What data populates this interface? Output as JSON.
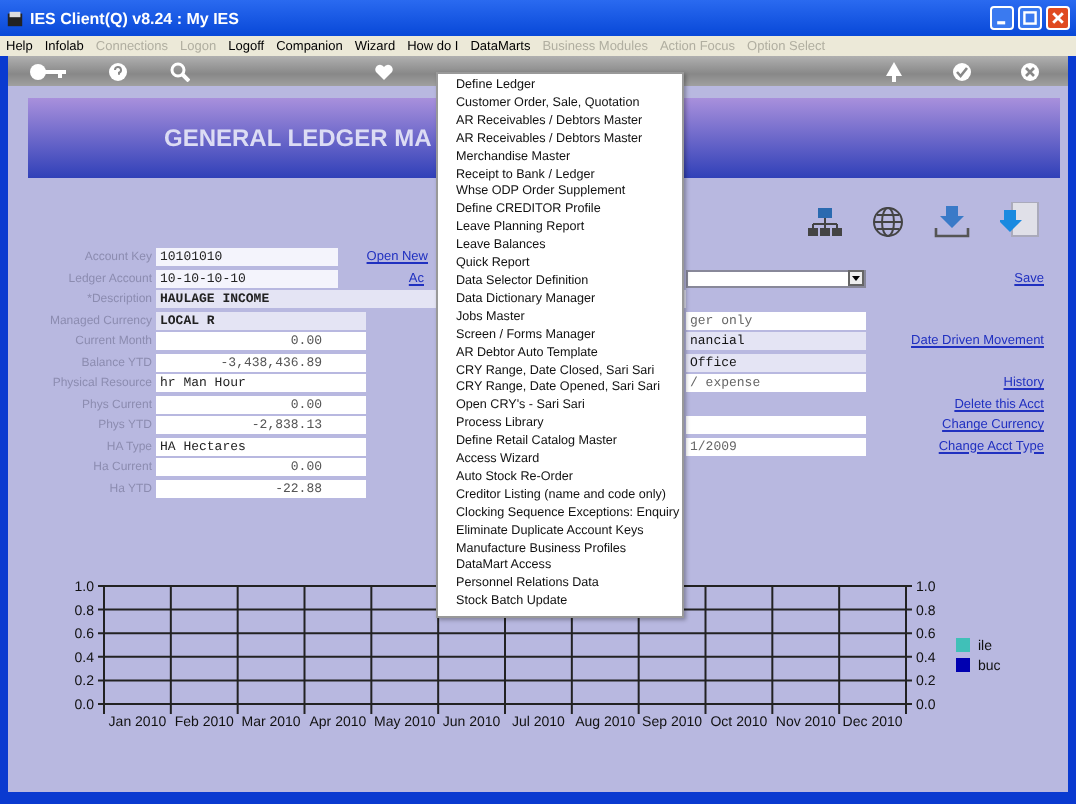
{
  "window": {
    "title": "IES Client(Q) v8.24 : My IES"
  },
  "menu_bar": [
    {
      "label": "Help",
      "disabled": false
    },
    {
      "label": "Infolab",
      "disabled": false
    },
    {
      "label": "Connections",
      "disabled": true
    },
    {
      "label": "Logon",
      "disabled": true
    },
    {
      "label": "Logoff",
      "disabled": false
    },
    {
      "label": "Companion",
      "disabled": false
    },
    {
      "label": "Wizard",
      "disabled": false
    },
    {
      "label": "How do I",
      "disabled": false
    },
    {
      "label": "DataMarts",
      "disabled": false
    },
    {
      "label": "Business Modules",
      "disabled": true
    },
    {
      "label": "Action Focus",
      "disabled": true
    },
    {
      "label": "Option Select",
      "disabled": true
    }
  ],
  "banner": {
    "title": "GENERAL LEDGER MA"
  },
  "form": {
    "fields": [
      {
        "label": "Account Key",
        "value": "10101010",
        "kind": "key"
      },
      {
        "label": "Ledger Account",
        "value": "10-10-10-10",
        "kind": "key"
      },
      {
        "label": "*Description",
        "value": "HAULAGE INCOME",
        "kind": "wide"
      },
      {
        "label": "Managed Currency",
        "value": "LOCAL R",
        "kind": "text"
      },
      {
        "label": "Current Month",
        "value": "0.00",
        "kind": "number"
      },
      {
        "label": "Balance YTD",
        "value": "-3,438,436.89",
        "kind": "number"
      },
      {
        "label": "Physical Resource",
        "value": "hr Man Hour",
        "kind": "text"
      },
      {
        "label": "Phys Current",
        "value": "0.00",
        "kind": "number"
      },
      {
        "label": "Phys YTD",
        "value": "-2,838.13",
        "kind": "number"
      },
      {
        "label": "HA Type",
        "value": "HA Hectares",
        "kind": "text"
      },
      {
        "label": "Ha Current",
        "value": "0.00",
        "kind": "number"
      },
      {
        "label": "Ha YTD",
        "value": "-22.88",
        "kind": "number"
      }
    ],
    "mid_links": [
      "Open New",
      "Ac"
    ],
    "right_fields": [
      {
        "kind": "dropdown"
      },
      {
        "kind": "blank"
      },
      {
        "kind": "field",
        "value": "ger only"
      },
      {
        "kind": "field",
        "value": "nancial"
      },
      {
        "kind": "field",
        "value": "Office"
      },
      {
        "kind": "field",
        "value": "/ expense"
      },
      {
        "kind": "blank"
      },
      {
        "kind": "field"
      },
      {
        "kind": "field",
        "value": "1/2009"
      }
    ],
    "action_links": [
      "Save",
      "Date Driven Movement",
      "History",
      "Delete this Acct",
      "Change Currency",
      "Change Acct Type"
    ]
  },
  "chart": {
    "chart_data": {
      "type": "line",
      "grid": true,
      "categories": [
        "Jan 2010",
        "Feb 2010",
        "Mar 2010",
        "Apr 2010",
        "May 2010",
        "Jun 2010",
        "Jul 2010",
        "Aug 2010",
        "Sep 2010",
        "Oct 2010",
        "Nov 2010",
        "Dec 2010"
      ],
      "ylim": [
        0,
        1
      ],
      "yticks": [
        {
          "value": 0,
          "label": "0.0"
        },
        {
          "value": 0.2,
          "label": "0.2"
        },
        {
          "value": 0.4,
          "label": "0.4"
        },
        {
          "value": 0.6,
          "label": "0.6"
        },
        {
          "value": 0.8,
          "label": "0.8"
        },
        {
          "value": 1,
          "label": "1.0"
        }
      ],
      "series": [
        {
          "name": "ile",
          "color": "#40c0b8",
          "values": [
            null,
            null,
            null,
            null,
            null,
            null,
            null,
            null,
            null,
            null,
            null,
            null
          ]
        },
        {
          "name": "buc",
          "color": "#0000b0",
          "values": [
            null,
            null,
            null,
            null,
            null,
            null,
            null,
            null,
            null,
            null,
            null,
            null
          ]
        }
      ]
    }
  },
  "dropdown_menu": [
    "Define Ledger",
    "Customer Order, Sale, Quotation",
    "AR Receivables / Debtors Master",
    "AR Receivables / Debtors Master",
    "Merchandise Master",
    "Receipt to Bank / Ledger",
    "Whse ODP Order Supplement",
    "Define CREDITOR Profile",
    "Leave Planning Report",
    "Leave Balances",
    "Quick Report",
    "Data Selector Definition",
    "Data Dictionary Manager",
    "Jobs Master",
    "Screen / Forms Manager",
    "AR Debtor Auto Template",
    "CRY Range, Date Closed, Sari Sari",
    "CRY Range, Date Opened, Sari Sari",
    "Open CRY's - Sari Sari",
    "Process Library",
    "Define Retail Catalog Master",
    "Access Wizard",
    "Auto Stock Re-Order",
    "Creditor Listing (name and code only)",
    "Clocking Sequence Exceptions: Enquiry",
    "Eliminate Duplicate Account Keys",
    "Manufacture Business Profiles",
    "DataMart Access",
    "Personnel Relations Data",
    "Stock Batch Update"
  ]
}
